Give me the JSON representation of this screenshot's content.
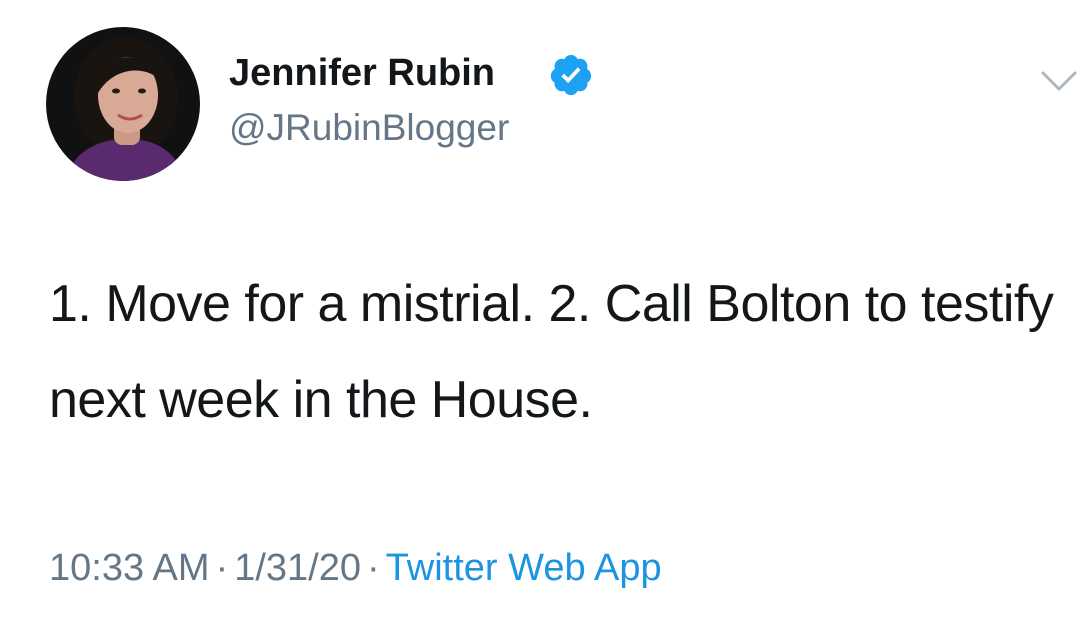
{
  "tweet": {
    "author": {
      "display_name": "Jennifer Rubin",
      "handle": "@JRubinBlogger",
      "verified": true,
      "avatar_icon": "profile-photo"
    },
    "text": "1. Move for a mistrial. 2. Call Bolton to testify next week in the House.",
    "time": "10:33 AM",
    "date": "1/31/20",
    "separator": "·",
    "source": "Twitter Web App"
  },
  "colors": {
    "text": "#14171a",
    "secondary": "#657786",
    "link": "#1b95e0",
    "verified_badge": "#1da1f2"
  },
  "icons": {
    "verified": "verified-badge-icon",
    "more": "chevron-down-icon"
  }
}
